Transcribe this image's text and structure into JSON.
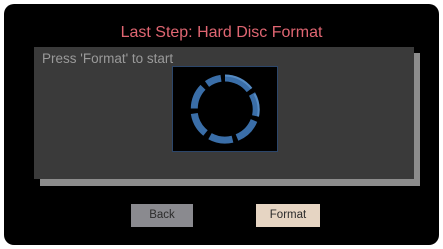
{
  "screen": {
    "title": "Last Step: Hard Disc Format"
  },
  "panel": {
    "instruction": "Press 'Format' to start",
    "spinner_icon": "loading-ring-icon"
  },
  "buttons": {
    "back_label": "Back",
    "format_label": "Format"
  },
  "colors": {
    "background": "#000000",
    "title": "#e06672",
    "panel": "#3a3a3a",
    "spinner": "#3a6ea8",
    "back_button": "#8a8a8f",
    "format_button": "#e6d5c3"
  }
}
